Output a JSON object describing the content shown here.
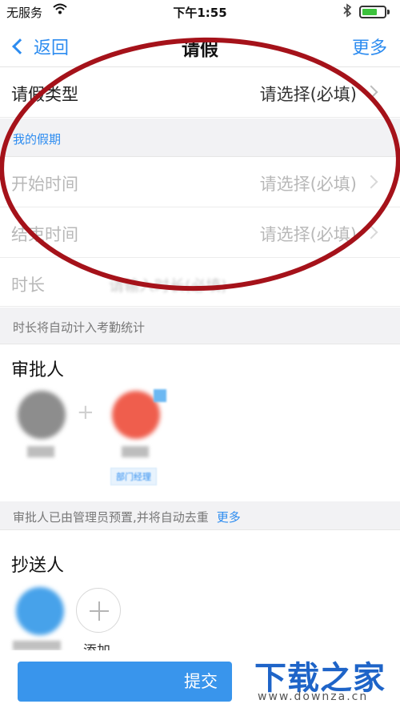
{
  "status_bar": {
    "carrier": "无服务",
    "wifi_icon": "wifi-icon",
    "time": "下午1:55",
    "bluetooth_icon": "bluetooth-icon",
    "battery_level": 0.7,
    "battery_color": "#3cc23c"
  },
  "nav": {
    "back_label": "返回",
    "title": "请假",
    "more_label": "更多",
    "accent_color": "#2d8cf0"
  },
  "form": {
    "leave_type": {
      "label": "请假类型",
      "value": "请选择(必填)"
    },
    "section_my_leave": "我的假期",
    "start_time": {
      "label": "开始时间",
      "value": "请选择(必填)"
    },
    "end_time": {
      "label": "结束时间",
      "value": "请选择(必填)"
    },
    "duration": {
      "label": "时长",
      "placeholder": "请输入时长(必填)"
    },
    "duration_note": "时长将自动计入考勤统计"
  },
  "approvers": {
    "title": "审批人",
    "role_tag": "部门经理",
    "note": "审批人已由管理员预置,并将自动去重",
    "note_more": "更多"
  },
  "cc": {
    "title": "抄送人",
    "add_label": "添加"
  },
  "bottom": {
    "submit_label": "提交",
    "watermark_logo": "下载之家",
    "watermark_url": "www.downza.cn"
  },
  "annotation": {
    "ellipse_color": "#a5121a"
  }
}
